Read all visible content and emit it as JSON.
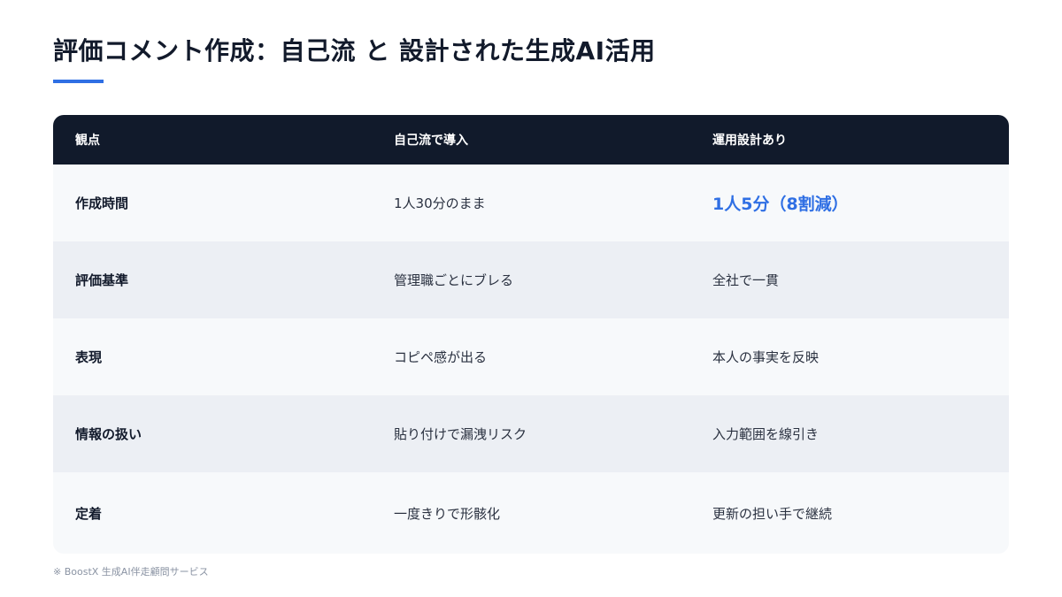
{
  "title": "評価コメント作成：自己流 と 設計された生成AI活用",
  "colors": {
    "accent": "#2f6fe4",
    "header_bg": "#111a2b"
  },
  "table": {
    "headers": [
      "観点",
      "自己流で導入",
      "運用設計あり"
    ],
    "rows": [
      [
        "作成時間",
        "1人30分のまま",
        "1人5分（8割減）"
      ],
      [
        "評価基準",
        "管理職ごとにブレる",
        "全社で一貫"
      ],
      [
        "表現",
        "コピペ感が出る",
        "本人の事実を反映"
      ],
      [
        "情報の扱い",
        "貼り付けで漏洩リスク",
        "入力範囲を線引き"
      ],
      [
        "定着",
        "一度きりで形骸化",
        "更新の担い手で継続"
      ]
    ]
  },
  "footnote": "※ BoostX 生成AI伴走顧問サービス"
}
